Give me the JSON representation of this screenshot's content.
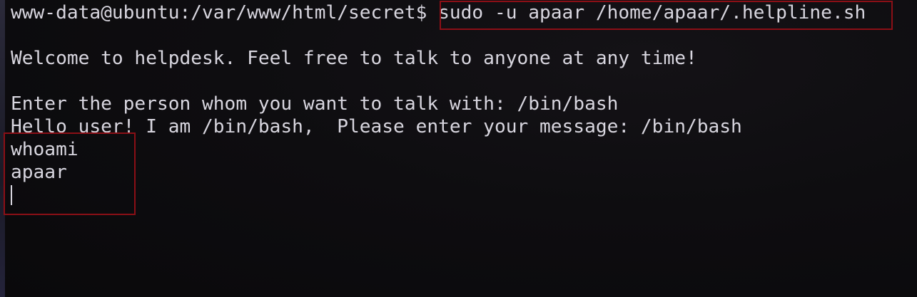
{
  "terminal": {
    "prompt": "www-data@ubuntu:/var/www/html/secret$ ",
    "command": "sudo -u apaar /home/apaar/.helpline.sh",
    "lines": [
      "Welcome to helpdesk. Feel free to talk to anyone at any time!",
      "Enter the person whom you want to talk with: /bin/bash",
      "Hello user! I am /bin/bash,  Please enter your message: /bin/bash",
      "whoami",
      "apaar"
    ]
  },
  "colors": {
    "background": "#0d0c0e",
    "text": "#d8d6df",
    "highlight": "#8b0f16"
  }
}
